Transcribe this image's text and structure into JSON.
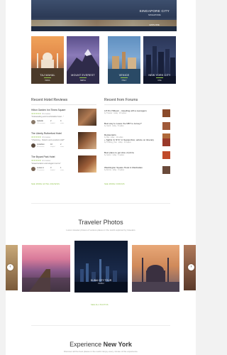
{
  "hero": {
    "city": "SINGAPORE CITY",
    "subtitle": "SINGAPORE",
    "button": "EXPLORE"
  },
  "destinations": [
    {
      "name": "TAJ MAHAL",
      "tag": "INDIA"
    },
    {
      "name": "MOUNT EVEREST",
      "tag": "NEPAL"
    },
    {
      "name": "VENICE",
      "tag": "ITALY"
    },
    {
      "name": "NEW YORK CITY",
      "tag": "USA"
    }
  ],
  "reviews": {
    "title": "Recent Hotel Reviews",
    "items": [
      {
        "title": "Hilton Garden Inn Times Square",
        "reviews": "15 reviews",
        "quote": "\"Outstanding and Comfortable hotel...\"",
        "author": "Isabelle",
        "meta": "120 reviews",
        "stat1": "2",
        "stat1_label": "helpful",
        "stat2": "4",
        "stat2_label": "votes"
      },
      {
        "title": "The Liberty Rutherford Hotel",
        "reviews": "13 reviews",
        "quote": "\"Charming - historic and excellent staff\"",
        "author": "Jonathan",
        "meta": "98 reviews",
        "stat1": "10",
        "stat1_label": "helpful",
        "stat2": "2",
        "stat2_label": "votes"
      },
      {
        "title": "The Bryant Park Hotel",
        "reviews": "12 reviews",
        "quote": "\"Great location and elegant rooms\"",
        "author": "Lucas H.",
        "meta": "76 reviews",
        "stat1": "3",
        "stat1_label": "helpful",
        "stat2": "1",
        "stat2_label": "votes"
      }
    ],
    "more": "SEE MORE HOTEL REVIEWS"
  },
  "forums": {
    "title": "Recent from Forums",
    "items": [
      {
        "title": "LP Pro Hilltown - travelling with a teenagers",
        "meta": "by Traveler  ·  today  ·  20 replies"
      },
      {
        "title": "Best way to Leave the NBT to Jersey?",
        "meta": "by Jacob  ·  today  ·  8 replies"
      },
      {
        "title": "Restaurants",
        "meta": "by Mia  ·  today  ·  12 replies"
      },
      {
        "title": "+ Sights 'in NYC' in Septembrer, advice on itinerary",
        "meta": "by Thinking_Over  ·  today  ·  14 replies"
      },
      {
        "title": "Best place to get slice of pizza",
        "meta": "by Garret  ·  today  ·  6 replies"
      },
      {
        "title": "Washington Square Hotel in Manhattan",
        "meta": "by Emma  ·  today  ·  9 replies"
      }
    ],
    "more": "SEE MORE FORUMS"
  },
  "photos": {
    "title": "Traveler Photos",
    "subtitle": "Lorem traveler photos of various places in the world explored by travelers",
    "featured_caption": "DUBAI CITY TOUR",
    "featured_sub": "DUBAI",
    "more": "SEE ALL PHOTOS"
  },
  "experience": {
    "title_prefix": "Experience",
    "title_strong": "New York",
    "subtitle": "Discover all the best places in the world. Enjoy every minute of the experience"
  },
  "colors": {
    "accent": "#8fc34a"
  }
}
